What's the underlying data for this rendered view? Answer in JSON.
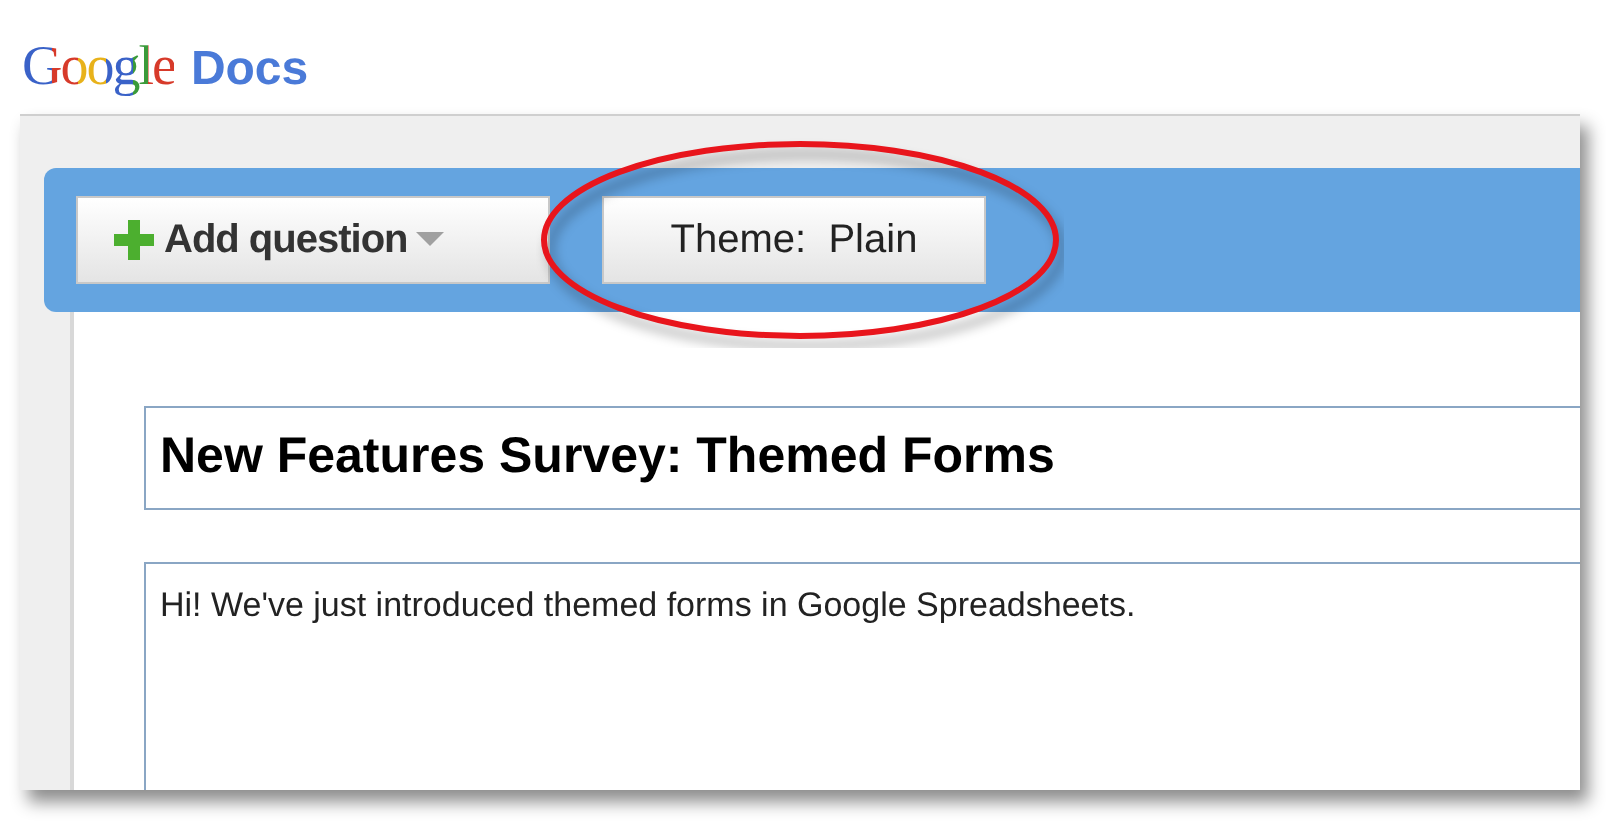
{
  "logo": {
    "brand": "Google",
    "product": "Docs"
  },
  "toolbar": {
    "buttons": [
      {
        "kind": "menu",
        "label": "Add question"
      },
      {
        "kind": "plain",
        "label": "Theme:  Plain"
      }
    ]
  },
  "annotation": {
    "kind": "ellipse"
  },
  "form": {
    "title": "New Features Survey: Themed Forms",
    "description": "Hi! We've just introduced themed forms in Google Spreadsheets."
  }
}
